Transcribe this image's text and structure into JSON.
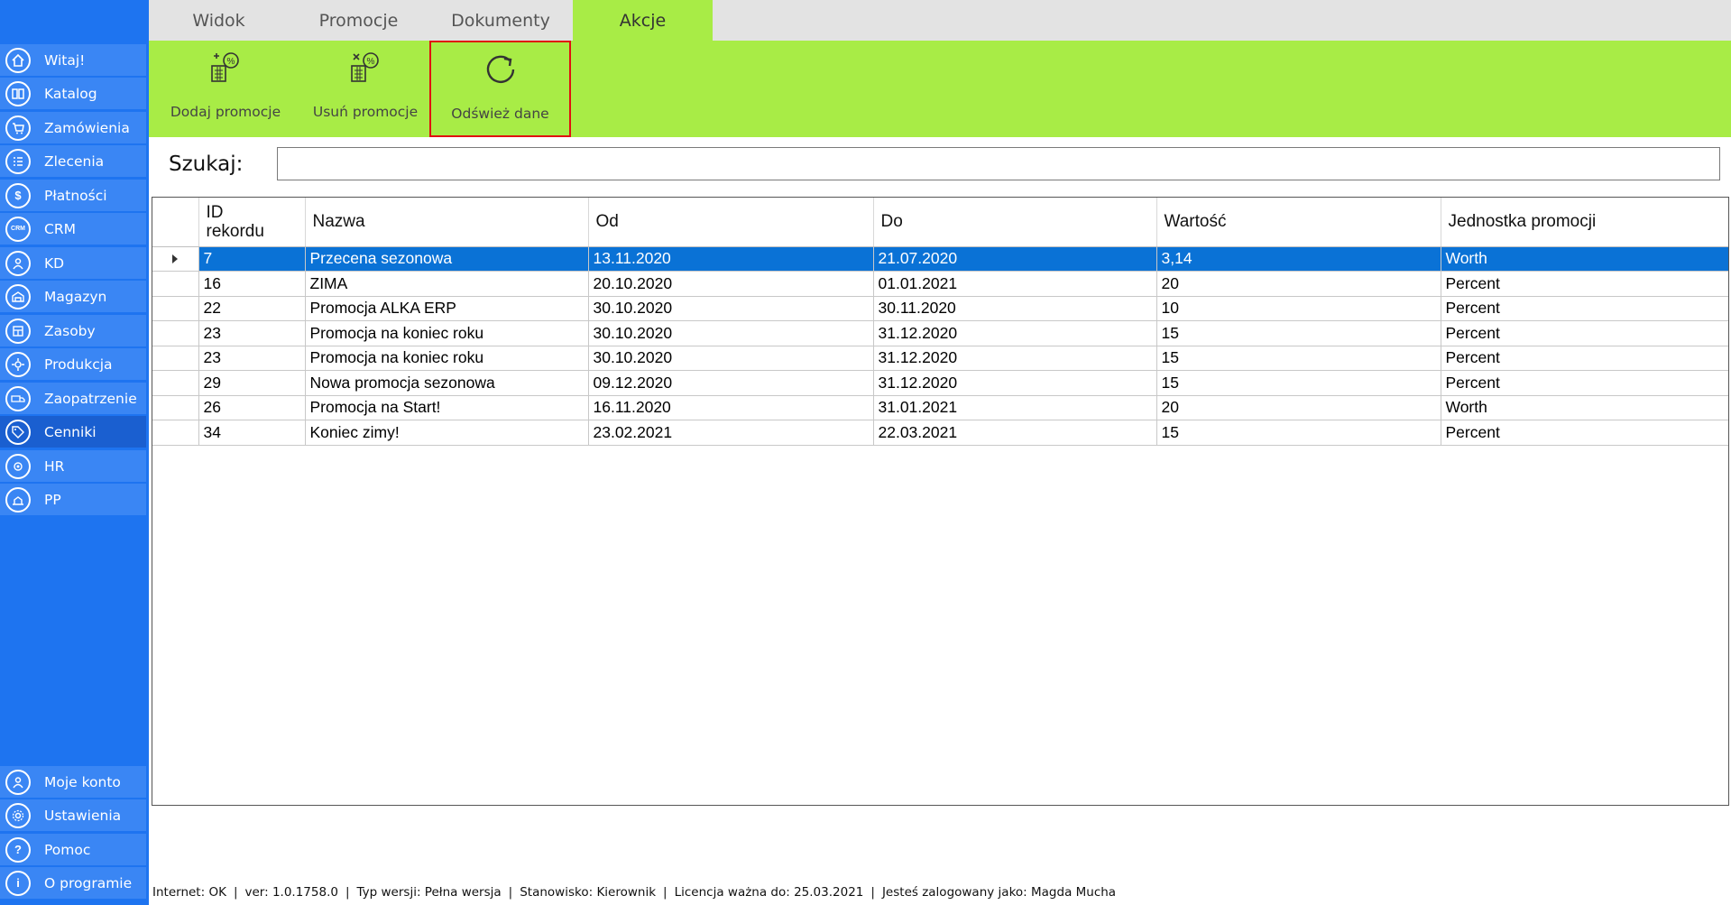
{
  "sidebar": {
    "items": [
      {
        "label": "Witaj!",
        "icon": "home-icon"
      },
      {
        "label": "Katalog",
        "icon": "book-icon"
      },
      {
        "label": "Zamówienia",
        "icon": "cart-icon"
      },
      {
        "label": "Zlecenia",
        "icon": "list-icon"
      },
      {
        "label": "Płatności",
        "icon": "dollar-icon"
      },
      {
        "label": "CRM",
        "icon": "crm-icon"
      },
      {
        "label": "KD",
        "icon": "person-icon"
      },
      {
        "label": "Magazyn",
        "icon": "warehouse-icon"
      },
      {
        "label": "Zasoby",
        "icon": "resources-icon"
      },
      {
        "label": "Produkcja",
        "icon": "production-icon"
      },
      {
        "label": "Zaopatrzenie",
        "icon": "supply-icon"
      },
      {
        "label": "Cenniki",
        "icon": "tag-icon"
      },
      {
        "label": "HR",
        "icon": "hr-icon"
      },
      {
        "label": "PP",
        "icon": "pp-icon"
      }
    ],
    "bottom_items": [
      {
        "label": "Moje konto",
        "icon": "account-icon"
      },
      {
        "label": "Ustawienia",
        "icon": "settings-icon"
      },
      {
        "label": "Pomoc",
        "icon": "help-icon"
      },
      {
        "label": "O programie",
        "icon": "info-icon"
      }
    ],
    "active": "Cenniki"
  },
  "tabs": [
    {
      "label": "Widok"
    },
    {
      "label": "Promocje"
    },
    {
      "label": "Dokumenty"
    },
    {
      "label": "Akcje"
    }
  ],
  "active_tab": "Akcje",
  "toolbar": {
    "add_label": "Dodaj promocje",
    "remove_label": "Usuń promocje",
    "refresh_label": "Odśwież dane"
  },
  "search": {
    "label": "Szukaj:",
    "value": ""
  },
  "grid": {
    "columns": [
      "ID rekordu",
      "Nazwa",
      "Od",
      "Do",
      "Wartość",
      "Jednostka promocji"
    ],
    "rows": [
      [
        "7",
        "Przecena sezonowa",
        "13.11.2020",
        "21.07.2020",
        "3,14",
        "Worth"
      ],
      [
        "16",
        "ZIMA",
        "20.10.2020",
        "01.01.2021",
        "20",
        "Percent"
      ],
      [
        "22",
        "Promocja ALKA ERP",
        "30.10.2020",
        "30.11.2020",
        "10",
        "Percent"
      ],
      [
        "23",
        "Promocja na koniec roku",
        "30.10.2020",
        "31.12.2020",
        "15",
        "Percent"
      ],
      [
        "23",
        "Promocja na koniec roku",
        "30.10.2020",
        "31.12.2020",
        "15",
        "Percent"
      ],
      [
        "29",
        "Nowa promocja sezonowa",
        "09.12.2020",
        "31.12.2020",
        "15",
        "Percent"
      ],
      [
        "26",
        "Promocja na Start!",
        "16.11.2020",
        "31.01.2021",
        "20",
        "Worth"
      ],
      [
        "34",
        "Koniec zimy!",
        "23.02.2021",
        "22.03.2021",
        "15",
        "Percent"
      ]
    ],
    "selected_row": 0
  },
  "status": {
    "internet": "Internet: OK",
    "version": "ver: 1.0.1758.0",
    "type": "Typ wersji: Pełna wersja",
    "position": "Stanowisko: Kierownik",
    "license": "Licencja ważna do: 25.03.2021",
    "user": "Jesteś zalogowany jako: Magda Mucha"
  },
  "colors": {
    "sidebar_bg": "#1e74f0",
    "sidebar_item": "#3a86f4",
    "ribbon_green": "#a8ec46",
    "selection": "#0a72d6",
    "highlight_border": "#e01010"
  }
}
